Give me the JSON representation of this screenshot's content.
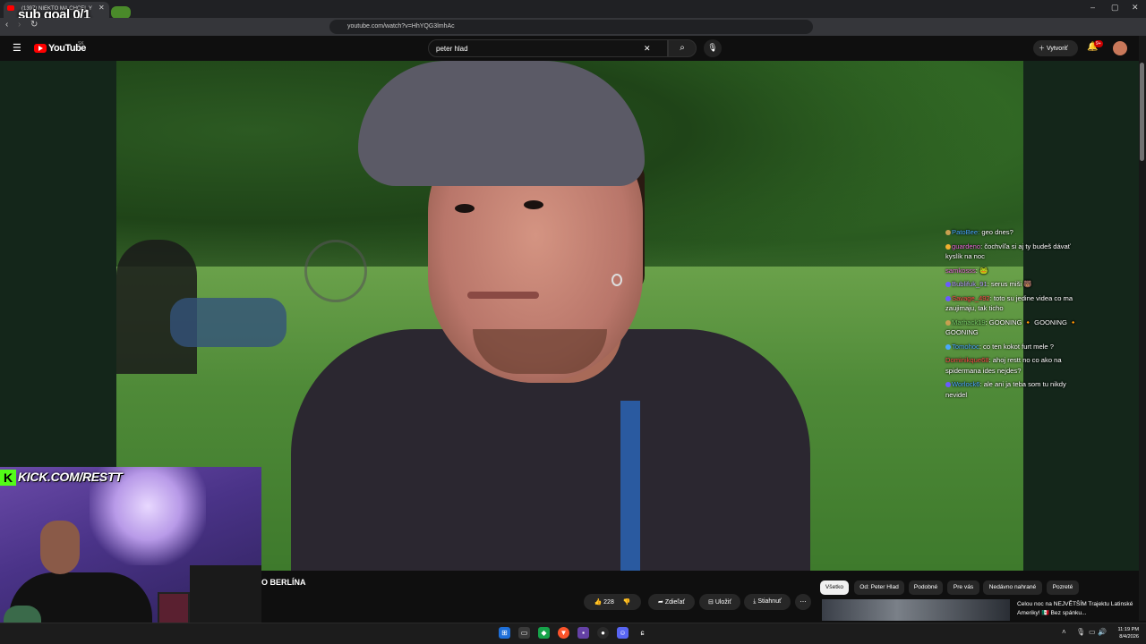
{
  "browser": {
    "tab_title": "(1397) NIEKTO MA CHCEL Y",
    "url": "youtube.com/watch?v=HhYQG3lmhAc",
    "controls": {
      "back": "‹",
      "forward": "›",
      "reload": "↻",
      "minimize": "–",
      "maximize": "▢",
      "close": "✕"
    }
  },
  "stream_overlay": {
    "sub_goal": "sub goal 0/1",
    "kick_logo": "K",
    "kick_url": "KICK.COM/RESTT"
  },
  "youtube": {
    "logo": "YouTube",
    "country": "SK",
    "search_value": "peter hlad",
    "create_label": "Vytvoriť",
    "notifications_badge": "9+"
  },
  "chat": [
    {
      "user": "PatoBee:",
      "user_color": "#4aa8ff",
      "badge_color": "#c8a050",
      "message": " geo dnes?"
    },
    {
      "user": "guardeno",
      "user_color": "#e86ad8",
      "badge_color": "#f0b030",
      "message": ": čochvíľa si aj ty budeš dávať kyslík na noc"
    },
    {
      "user": "samkosss",
      "user_color": "#e86ad8",
      "badge_color": "",
      "message": ": 🐸"
    },
    {
      "user": "Bublifuk_91",
      "user_color": "#b8a0ff",
      "badge_color": "#6a5aff",
      "message": ": serus miši 🐻"
    },
    {
      "user": "Savage_492",
      "user_color": "#ff4a4a",
      "badge_color": "#6a5aff",
      "message": ": toto su jedine videa co ma zaujimaju, tak ticho"
    },
    {
      "user": "Marhack19",
      "user_color": "#7ad06a",
      "badge_color": "#c8a050",
      "message": ": GOONING 🔸 GOONING 🔸 GOONING"
    },
    {
      "user": "Tomohoc",
      "user_color": "#4aa8ff",
      "badge_color": "#4aa8ff",
      "message": ": co ten kokot furt mele ?"
    },
    {
      "user": "Dominikque68",
      "user_color": "#ff4a4a",
      "badge_color": "",
      "message": ": ahoj restt no co ako na spidermana ides nejdes?"
    },
    {
      "user": "Worlock6",
      "user_color": "#4aa8ff",
      "badge_color": "#6a5aff",
      "message": ": ale ani ja teba som tu nikdy nevidel"
    }
  ],
  "video": {
    "title_fragment": "O BERLÍNA",
    "likes": "228",
    "share_label": "Zdieľať",
    "save_label": "Uložiť",
    "download_label": "Stiahnuť",
    "more": "⋯"
  },
  "filter_chips": [
    "Všetko",
    "Od: Peter Hlad",
    "Podobné",
    "Pre vás",
    "Nedávno nahrané",
    "Pozreté"
  ],
  "recommendation": {
    "title": "Celou noc na NEJVĚTŠÍM Trajektu Latinské Ameriky!",
    "subtitle_suffix": " Bez spánku..."
  },
  "taskbar": {
    "clock_time": "11:19 PM",
    "clock_date": "8/4/2026"
  },
  "colors": {
    "accent_red": "#ff0000",
    "kick_green": "#53fc18",
    "background": "#0f0f0f"
  }
}
